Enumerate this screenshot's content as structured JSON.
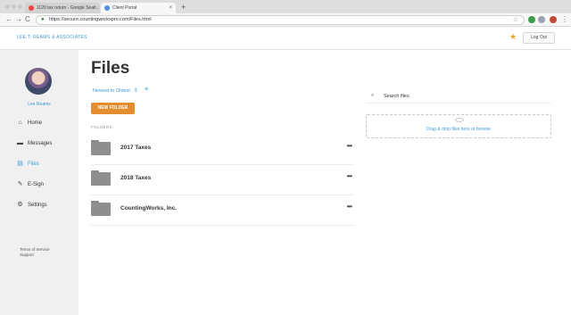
{
  "browser": {
    "tabs": [
      {
        "label": "1120 tax return - Google Sear...",
        "favicon_color": "#e8453c"
      },
      {
        "label": "Client Portal",
        "favicon_color": "#4a8fe0"
      }
    ],
    "new_tab": "+",
    "address": "https://secure.countingworkspro.com/Files.html",
    "nav": {
      "back": "←",
      "forward": "→",
      "reload": "C"
    }
  },
  "header": {
    "brand": "LEE T. REAMS & ASSOCIATES",
    "logout": "Log Out",
    "accent": "#3a9bd8"
  },
  "sidebar": {
    "user_name": "Lee Reams",
    "items": [
      {
        "label": "Home",
        "icon": "home-icon",
        "glyph": "⌂",
        "active": false
      },
      {
        "label": "Messages",
        "icon": "message-icon",
        "glyph": "▬",
        "active": false
      },
      {
        "label": "Files",
        "icon": "file-icon",
        "glyph": "▤",
        "active": true
      },
      {
        "label": "E-Sign",
        "icon": "pen-icon",
        "glyph": "✎",
        "active": false
      },
      {
        "label": "Settings",
        "icon": "gear-icon",
        "glyph": "⚙",
        "active": false
      }
    ],
    "footer": {
      "terms": "Terms of Service",
      "support": "Support"
    }
  },
  "main": {
    "title": "Files",
    "sort_label": "Newest to Oldest",
    "new_folder": "NEW FOLDER",
    "section_label": "FOLDERS",
    "folders": [
      {
        "name": "2017 Taxes",
        "more": "•••"
      },
      {
        "name": "2018 Taxes",
        "more": "•••"
      },
      {
        "name": "CountingWorks, Inc.",
        "more": "•••"
      }
    ]
  },
  "panel": {
    "search_placeholder": "Search files",
    "dropzone_text": "Drag & drop files here or browse"
  }
}
